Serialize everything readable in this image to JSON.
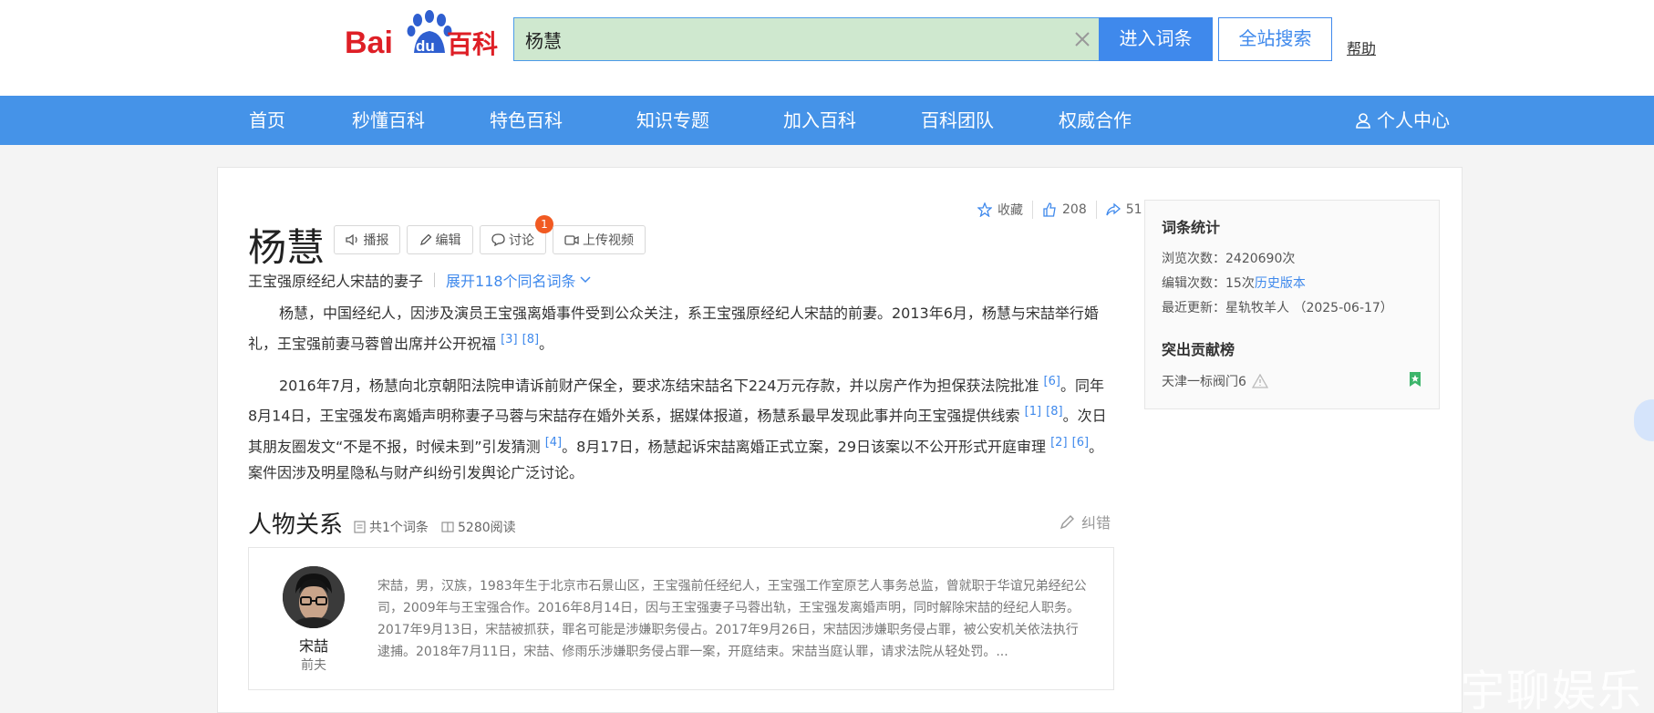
{
  "logo": {
    "text_a": "Bai",
    "text_b": "du",
    "text_c": "百科"
  },
  "search": {
    "value": "杨慧",
    "enter_label": "进入词条",
    "site_label": "全站搜索",
    "help_label": "帮助"
  },
  "nav": {
    "items": [
      "首页",
      "秒懂百科",
      "特色百科",
      "知识专题",
      "加入百科",
      "百科团队",
      "权威合作"
    ],
    "user_label": "个人中心"
  },
  "entry": {
    "title": "杨慧",
    "buttons": {
      "broadcast": "播报",
      "edit": "编辑",
      "discuss": "讨论",
      "upload_video": "上传视频"
    },
    "discuss_badge": "1",
    "actions": {
      "favorite": "收藏",
      "likes": "208",
      "shares": "51"
    },
    "subtitle": "王宝强原经纪人宋喆的妻子",
    "same_name": "展开118个同名词条",
    "para1": {
      "text": "杨慧，中国经纪人，因涉及演员王宝强离婚事件受到公众关注，系王宝强原经纪人宋喆的前妻。2013年6月，杨慧与宋喆举行婚礼，王宝强前妻马蓉曾出席并公开祝福",
      "refs": [
        "[3]",
        "[8]"
      ],
      "end": "。"
    },
    "para2": {
      "s1": "2016年7月，杨慧向北京朝阳法院申请诉前财产保全，要求冻结宋喆名下224万元存款，并以房产作为担保获法院批准",
      "r1": "[6]",
      "s2": "。同年8月14日，王宝强发布离婚声明称妻子马蓉与宋喆存在婚外关系，据媒体报道，杨慧系最早发现此事并向王宝强提供线索",
      "r2": "[1]",
      "r3": "[8]",
      "s3": "。次日其朋友圈发文“不是不报，时候未到”引发猜测",
      "r4": "[4]",
      "s4": "。8月17日，杨慧起诉宋喆离婚正式立案，29日该案以不公开形式开庭审理",
      "r5": "[2]",
      "r6": "[6]",
      "s5": "。案件因涉及明星隐私与财产纠纷引发舆论广泛讨论。"
    }
  },
  "relations": {
    "title": "人物关系",
    "count": "共1个词条",
    "reads": "5280阅读",
    "correction": "纠错",
    "person": {
      "name": "宋喆",
      "role": "前夫",
      "desc": "宋喆，男，汉族，1983年生于北京市石景山区，王宝强前任经纪人，王宝强工作室原艺人事务总监，曾就职于华谊兄弟经纪公司，2009年与王宝强合作。2016年8月14日，因与王宝强妻子马蓉出轨，王宝强发离婚声明，同时解除宋喆的经纪人职务。2017年9月13日，宋喆被抓获，罪名可能是涉嫌职务侵占。2017年9月26日，宋喆因涉嫌职务侵占罪，被公安机关依法执行逮捕。2018年7月11日，宋喆、修雨乐涉嫌职务侵占罪一案，开庭结束。宋喆当庭认罪，请求法院从轻处罚。..."
    }
  },
  "stats": {
    "title": "词条统计",
    "views_label": "浏览次数：",
    "views": "2420690次",
    "edits_label": "编辑次数：",
    "edits": "15次",
    "history": "历史版本",
    "updated_label": "最近更新：",
    "updated": "星轨牧羊人 （2025-06-17）",
    "contrib_title": "突出贡献榜",
    "contributor": "天津一标阀门6"
  },
  "watermark": "宇聊娱乐",
  "colors": {
    "brand_blue": "#4593e8",
    "link": "#3f89ec",
    "logo_red": "#de1f26",
    "logo_blue": "#2f5fd0",
    "badge": "#f15a22",
    "search_bg": "#cfe8cf"
  }
}
